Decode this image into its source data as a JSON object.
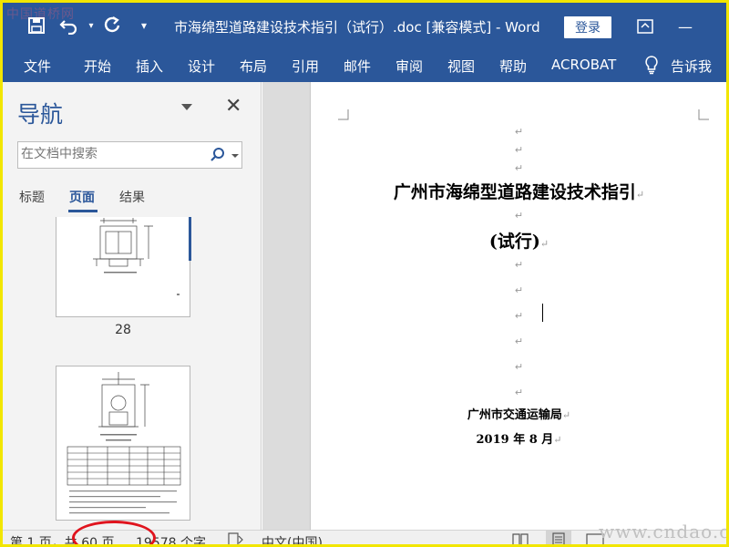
{
  "window": {
    "title": "市海绵型道路建设技术指引（试行）.doc [兼容模式]  -  Word",
    "login_label": "登录",
    "watermark_top": "中国道桥网",
    "watermark_bottom": "www.cndao.com"
  },
  "quick_access": {
    "save_icon": "save-icon",
    "undo_icon": "undo-icon",
    "redo_icon": "redo-icon",
    "customize_icon": "customize-icon"
  },
  "ribbon": {
    "tabs": [
      "文件",
      "开始",
      "插入",
      "设计",
      "布局",
      "引用",
      "邮件",
      "审阅",
      "视图",
      "帮助",
      "ACROBAT"
    ],
    "tell_me": "告诉我"
  },
  "nav": {
    "title": "导航",
    "search_placeholder": "在文档中搜索",
    "tabs": [
      "标题",
      "页面",
      "结果"
    ],
    "active_tab": "页面",
    "pages": [
      "28"
    ]
  },
  "document": {
    "title": "广州市海绵型道路建设技术指引",
    "subtitle": "(试行)",
    "authority": "广州市交通运输局",
    "date": "2019 年 8 月",
    "para_mark": "↵"
  },
  "status": {
    "page": "第 1 页，共 60 页",
    "words": "19578 个字",
    "language": "中文(中国)"
  },
  "colors": {
    "accent": "#2b579a",
    "highlight_frame": "#f2e600",
    "annotation": "#e0141e"
  }
}
